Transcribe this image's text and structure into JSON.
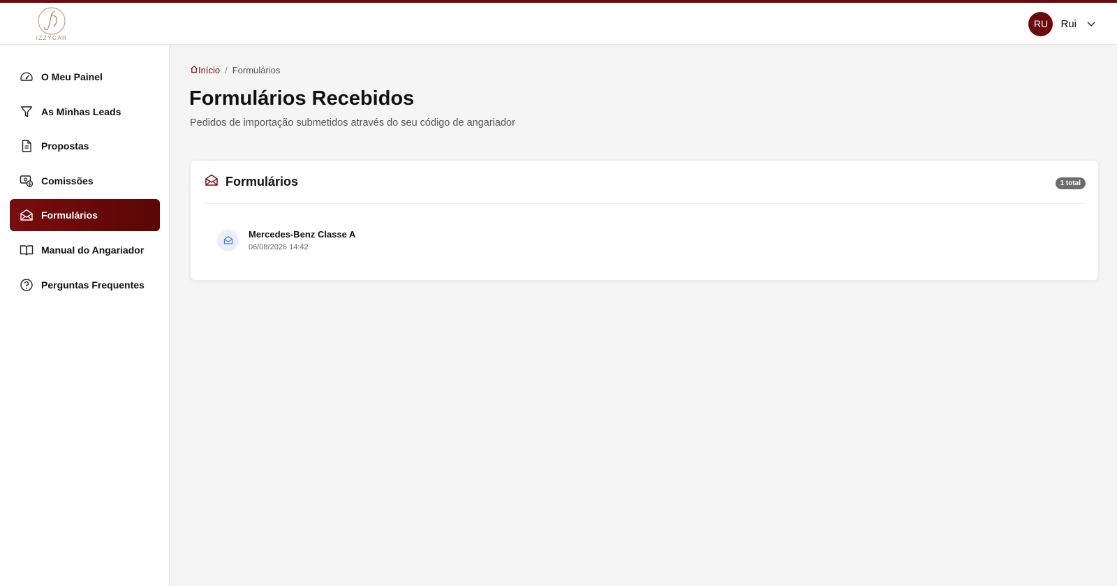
{
  "app": {
    "logo_text": "IZZYCAR",
    "brand_color": "#6b0a0a"
  },
  "user": {
    "initials": "RU",
    "name": "Rui",
    "menu_icon": "chevron-down-icon"
  },
  "sidebar": {
    "items": [
      {
        "label": "O Meu Painel",
        "icon": "dashboard-gauge-icon"
      },
      {
        "label": "As Minhas Leads",
        "icon": "filter-icon"
      },
      {
        "label": "Propostas",
        "icon": "document-icon"
      },
      {
        "label": "Comissões",
        "icon": "money-icon"
      },
      {
        "label": "Formulários",
        "icon": "mail-open-icon",
        "active": true
      },
      {
        "label": "Manual do Angariador",
        "icon": "book-icon"
      },
      {
        "label": "Perguntas Frequentes",
        "icon": "help-circle-icon"
      }
    ]
  },
  "breadcrumb": {
    "home": "Início",
    "separator": "/",
    "current": "Formulários"
  },
  "page": {
    "title": "Formulários Recebidos",
    "subtitle": "Pedidos de importação submetidos através do seu código de angariador"
  },
  "card": {
    "title": "Formulários",
    "badge": "1 total",
    "items": [
      {
        "title": "Mercedes-Benz Classe A",
        "date": "06/08/2026 14:42"
      }
    ]
  }
}
